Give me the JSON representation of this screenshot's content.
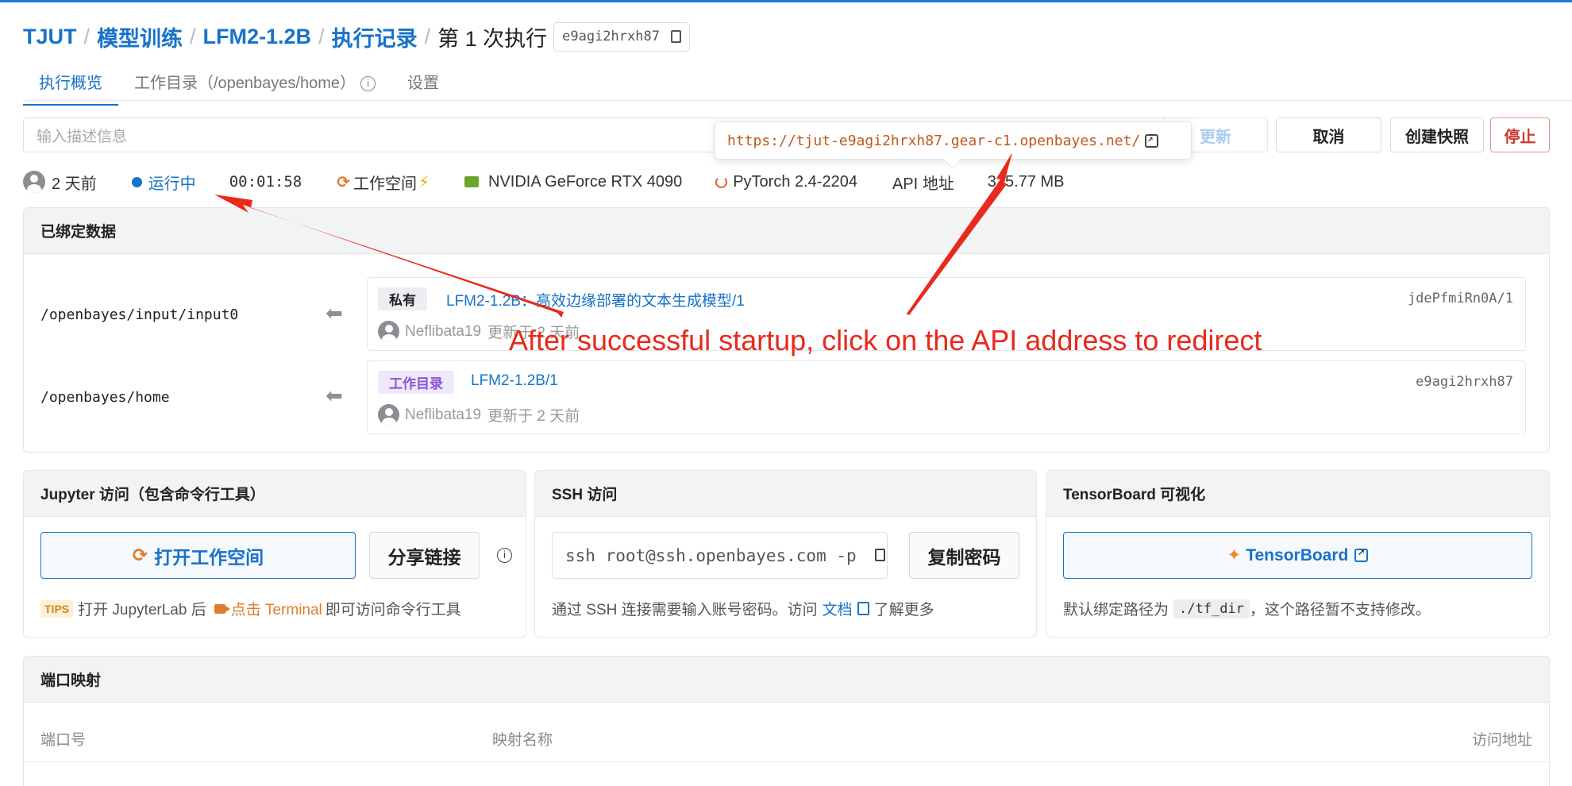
{
  "breadcrumb": {
    "org": "TJUT",
    "section": "模型训练",
    "project": "LFM2-1.2B",
    "records": "执行记录",
    "current": "第 1 次执行",
    "exec_id": "e9agi2hrxh87"
  },
  "tabs": [
    {
      "label": "执行概览",
      "active": true
    },
    {
      "label": "工作目录（/openbayes/home）",
      "active": false
    },
    {
      "label": "设置",
      "active": false
    }
  ],
  "description": {
    "placeholder": "输入描述信息"
  },
  "actions": {
    "update": "更新",
    "cancel": "取消",
    "snapshot": "创建快照",
    "stop": "停止"
  },
  "api_tooltip": {
    "url": "https://tjut-e9agi2hrxh87.gear-c1.openbayes.net/"
  },
  "status": {
    "created": "2 天前",
    "state": "运行中",
    "elapsed": "00:01:58",
    "workspace": "工作空间",
    "gpu": "NVIDIA GeForce RTX 4090",
    "framework": "PyTorch 2.4-2204",
    "api_label": "API 地址",
    "size": "315.77 MB"
  },
  "bound_data": {
    "title": "已绑定数据",
    "items": [
      {
        "path": "/openbayes/input/input0",
        "tag": "私有",
        "name": "LFM2-1.2B：高效边缘部署的文本生成模型/1",
        "id": "jdePfmiRn0A/1",
        "owner": "Neflibata19",
        "updated": "更新于 2 天前"
      },
      {
        "path": "/openbayes/home",
        "tag": "工作目录",
        "name": "LFM2-1.2B/1",
        "id": "e9agi2hrxh87",
        "owner": "Neflibata19",
        "updated": "更新于 2 天前"
      }
    ]
  },
  "jupyter": {
    "title": "Jupyter 访问（包含命令行工具）",
    "open_button": "打开工作空间",
    "share_button": "分享链接",
    "tips_badge": "TIPS",
    "tips_pre": "打开 JupyterLab 后",
    "tips_link": "点击 Terminal",
    "tips_post": "即可访问命令行工具"
  },
  "ssh": {
    "title": "SSH 访问",
    "command": "ssh root@ssh.openbayes.com -p",
    "copy_password": "复制密码",
    "note_pre": "通过 SSH 连接需要输入账号密码。访问",
    "note_link": "文档",
    "note_post": "了解更多"
  },
  "tensorboard": {
    "title": "TensorBoard 可视化",
    "button": "TensorBoard",
    "note_pre": "默认绑定路径为",
    "note_code": "./tf_dir",
    "note_post": "，这个路径暂不支持修改。"
  },
  "ports": {
    "title": "端口映射",
    "columns": [
      "端口号",
      "映射名称",
      "访问地址"
    ]
  },
  "annotation": {
    "text": "After successful startup, click on the API address to redirect",
    "color": "#e8291c"
  },
  "colors": {
    "primary": "#1772c9",
    "stop": "#d03a2f",
    "tooltip_url": "#c2571b"
  }
}
